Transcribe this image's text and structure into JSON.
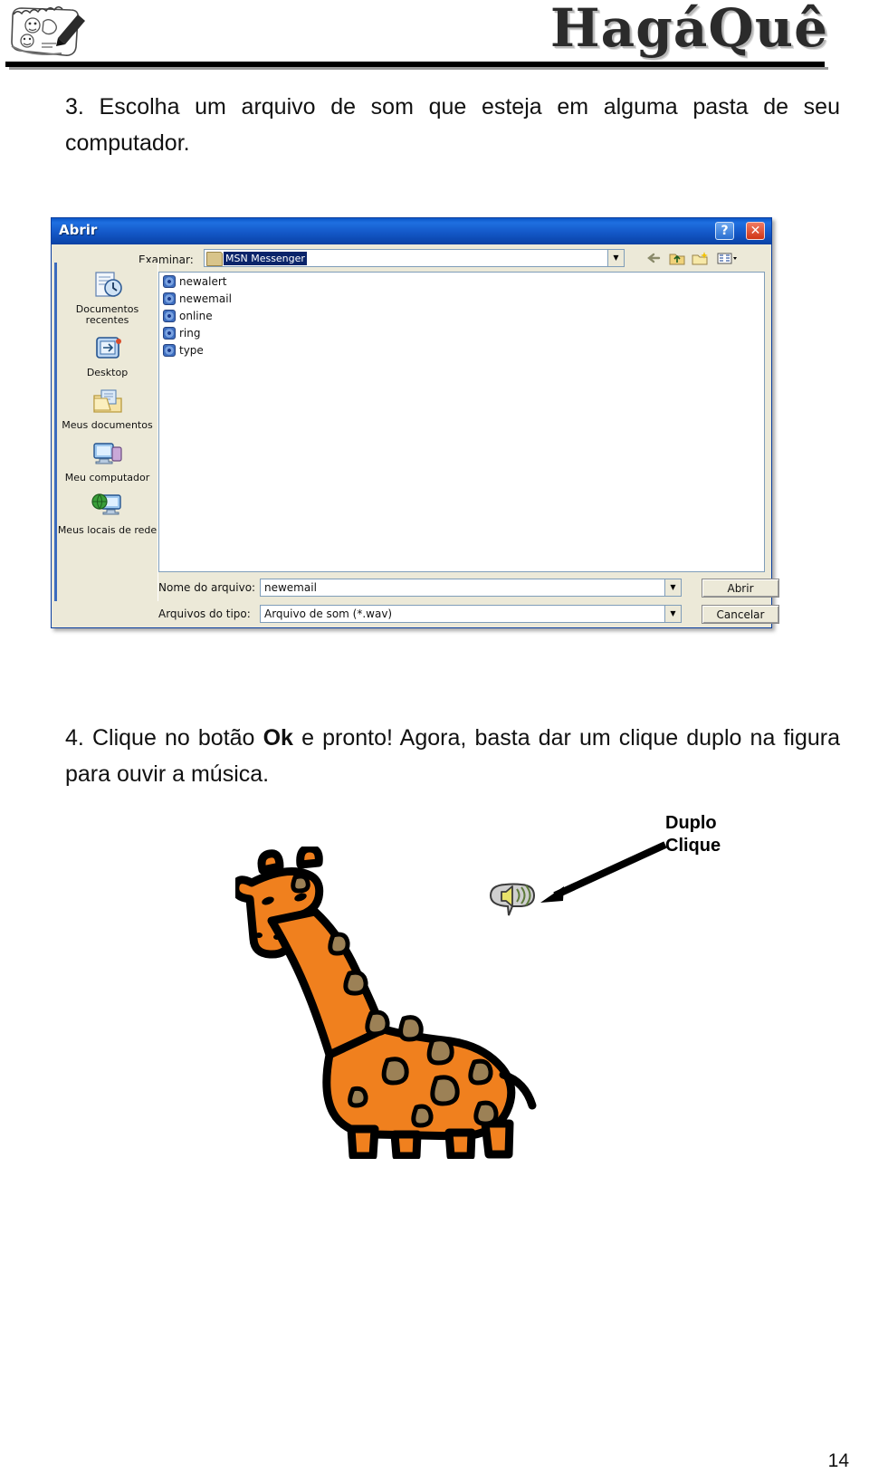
{
  "header": {
    "brand": "HagáQuê",
    "logo_icon": "comic-notebook-sketch-icon"
  },
  "steps": {
    "step3_num": "3.",
    "step3_text": "Escolha um arquivo de som que esteja em alguma pasta de seu computador.",
    "step4_num": "4.",
    "step4_a": "Clique no botão ",
    "step4_bold": "Ok",
    "step4_b": " e pronto! Agora, basta dar um clique duplo na figura para ouvir a música."
  },
  "dialog": {
    "title": "Abrir",
    "help_button": "?",
    "close_button": "✕",
    "lookin_label": "Examinar:",
    "lookin_value": "MSN Messenger",
    "toolbar": {
      "back": "back-arrow-icon",
      "up": "up-one-level-icon",
      "new_folder": "new-folder-icon",
      "views": "views-dropdown-icon"
    },
    "places": [
      {
        "label": "Documentos recentes",
        "icon": "recent-documents-icon"
      },
      {
        "label": "Desktop",
        "icon": "desktop-icon"
      },
      {
        "label": "Meus documentos",
        "icon": "my-documents-icon"
      },
      {
        "label": "Meu computador",
        "icon": "my-computer-icon"
      },
      {
        "label": "Meus locais de rede",
        "icon": "network-places-icon"
      }
    ],
    "files": [
      {
        "name": "newalert",
        "icon": "wav-file-icon"
      },
      {
        "name": "newemail",
        "icon": "wav-file-icon"
      },
      {
        "name": "online",
        "icon": "wav-file-icon"
      },
      {
        "name": "ring",
        "icon": "wav-file-icon"
      },
      {
        "name": "type",
        "icon": "wav-file-icon"
      }
    ],
    "filename_label": "Nome do arquivo:",
    "filename_value": "newemail",
    "filetype_label": "Arquivos do tipo:",
    "filetype_value": "Arquivo de som (*.wav)",
    "open_button": "Abrir",
    "cancel_button": "Cancelar"
  },
  "figure": {
    "annotation_line1": "Duplo",
    "annotation_line2": "Clique",
    "speaker_icon": "sound-balloon-icon",
    "giraffe_icon": "giraffe-drawing",
    "colors": {
      "giraffe_body": "#F0801E",
      "giraffe_spots": "#9C8156",
      "outline": "#000000",
      "titlebar_blue": "#1459C9",
      "dialog_face": "#ECE9D8",
      "selection_blue": "#0A246A"
    }
  },
  "page_number": "14"
}
